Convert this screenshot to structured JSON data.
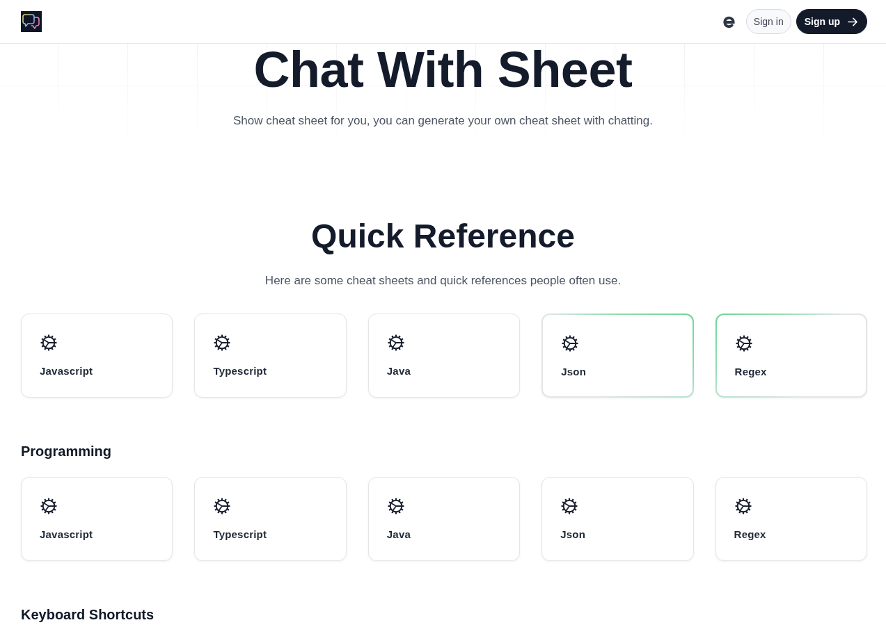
{
  "header": {
    "buttons": [
      {
        "label": "Sign in",
        "kind": "outline"
      },
      {
        "label": "Sign up",
        "kind": "primary"
      }
    ]
  },
  "hero": {
    "title": "Chat With Sheet",
    "subtitle": "Show cheat sheet for you, you can generate your own cheat sheet with chatting."
  },
  "quick_reference": {
    "title": "Quick Reference",
    "subtitle": "Here are some cheat sheets and quick references people often use.",
    "cards": [
      {
        "label": "Javascript",
        "glow_left": false,
        "glow_right": false
      },
      {
        "label": "Typescript",
        "glow_left": false,
        "glow_right": false
      },
      {
        "label": "Java",
        "glow_left": false,
        "glow_right": false
      },
      {
        "label": "Json",
        "glow_left": false,
        "glow_right": true
      },
      {
        "label": "Regex",
        "glow_left": true,
        "glow_right": false
      }
    ]
  },
  "sections": [
    {
      "title": "Programming",
      "cards": [
        {
          "label": "Javascript"
        },
        {
          "label": "Typescript"
        },
        {
          "label": "Java"
        },
        {
          "label": "Json"
        },
        {
          "label": "Regex"
        }
      ]
    },
    {
      "title": "Keyboard Shortcuts"
    }
  ]
}
